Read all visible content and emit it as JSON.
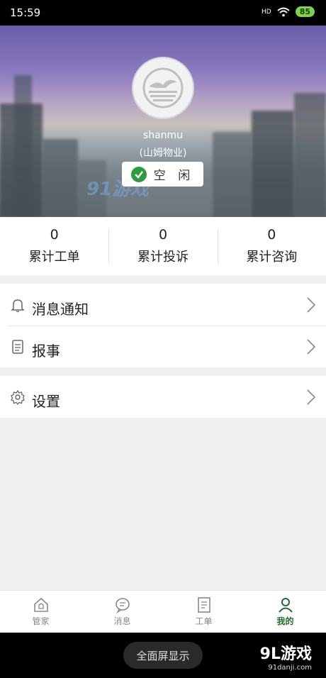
{
  "status_bar": {
    "time": "15:59",
    "signal": "HD",
    "battery": "85"
  },
  "profile": {
    "username": "shanmu",
    "company": "(山姆物业)",
    "status": "空 闲"
  },
  "watermark": "91游戏",
  "stats": [
    {
      "value": "0",
      "label": "累计工单"
    },
    {
      "value": "0",
      "label": "累计投诉"
    },
    {
      "value": "0",
      "label": "累计咨询"
    }
  ],
  "menu": {
    "notifications_label": "消息通知",
    "report_label": "报事",
    "settings_label": "设置"
  },
  "tabs": [
    {
      "label": "管家",
      "icon": "house-icon"
    },
    {
      "label": "消息",
      "icon": "chat-icon"
    },
    {
      "label": "工单",
      "icon": "document-icon"
    },
    {
      "label": "我的",
      "icon": "person-icon"
    }
  ],
  "nav": {
    "fullscreen_label": "全面屏显示",
    "logo_main": "9L游戏",
    "logo_sub": "91danji.com"
  },
  "colors": {
    "accent": "#1e6b30",
    "check": "#2e9b3d",
    "battery": "#7fd14a"
  }
}
